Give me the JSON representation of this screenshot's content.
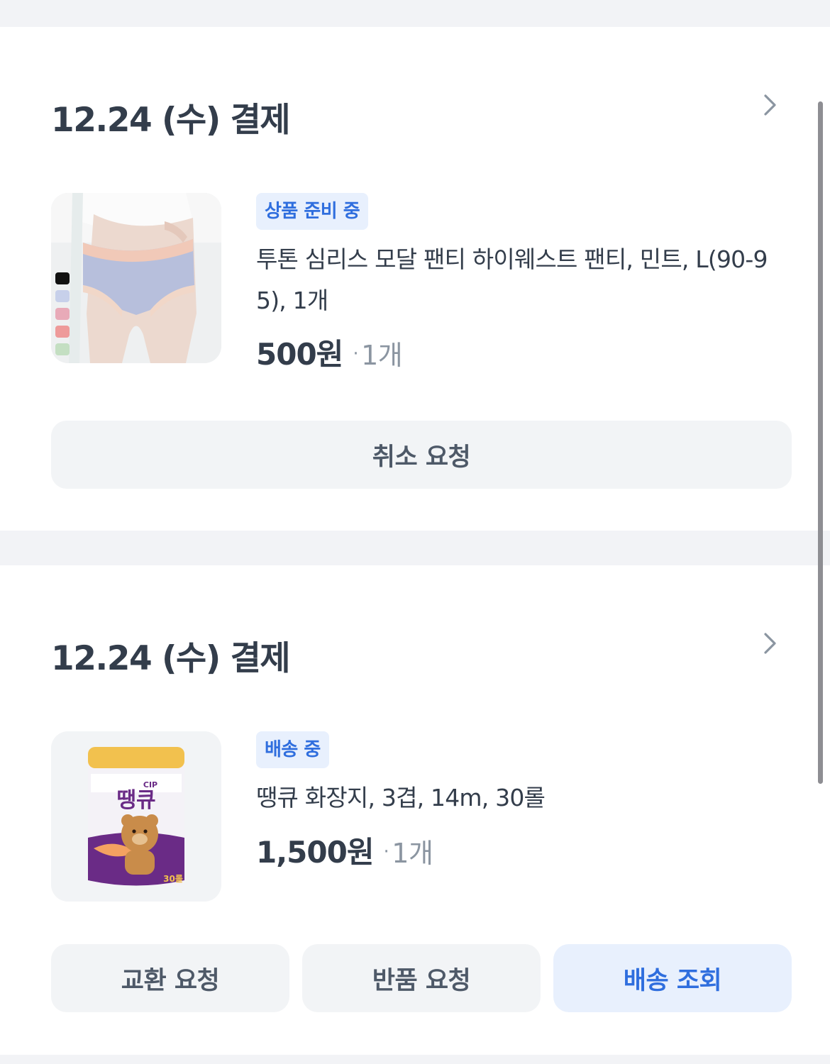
{
  "orders": [
    {
      "date_title": "12.24 (수) 결제",
      "status": "상품 준비 중",
      "product_name": "투톤 심리스 모달 팬티 하이웨스트 팬티, 민트, L(90-95), 1개",
      "price": "500원",
      "qty_dot": "·",
      "qty": "1개",
      "buttons": [
        "취소 요청"
      ]
    },
    {
      "date_title": "12.24 (수) 결제",
      "status": "배송 중",
      "product_name": "땡큐 화장지, 3겹, 14m, 30롤",
      "price": "1,500원",
      "qty_dot": "·",
      "qty": "1개",
      "buttons": [
        "교환 요청",
        "반품 요청",
        "배송 조회"
      ],
      "package_label": "땡큐",
      "package_sublabel": "CIP",
      "package_count": "30롤"
    }
  ],
  "colors": {
    "accent": "#2f6ede",
    "badge_bg": "#e8f0fd",
    "button_bg": "#f2f4f6",
    "page_bg": "#f2f3f6"
  },
  "icons": {
    "chevron": "chevron-right-icon"
  }
}
